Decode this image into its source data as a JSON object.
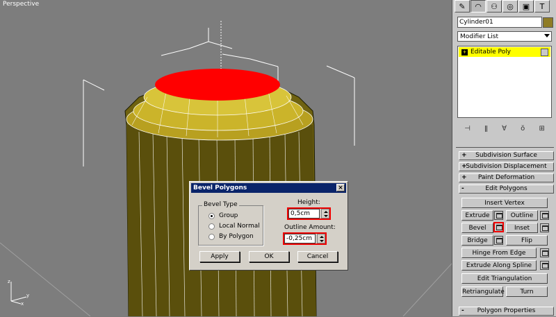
{
  "viewport": {
    "label": "Perspective",
    "colors": {
      "background": "#7d7d7d",
      "mesh": "#8c7a18",
      "selected_face": "#ff0000",
      "wire": "#ffffff"
    }
  },
  "command_panel": {
    "tabs": [
      "create-icon",
      "modify-icon",
      "hierarchy-icon",
      "motion-icon",
      "display-icon",
      "utilities-icon"
    ],
    "object_name": "Cylinder01",
    "object_color": "#8f7c25",
    "modifier_list": "Modifier List",
    "stack": {
      "item": "Editable Poly"
    }
  },
  "rollouts": {
    "subdivision_surface": {
      "sign": "+",
      "label": "Subdivision Surface"
    },
    "subdivision_displacement": {
      "sign": "+",
      "label": "Subdivision Displacement"
    },
    "paint_deformation": {
      "sign": "+",
      "label": "Paint Deformation"
    },
    "edit_polygons": {
      "sign": "-",
      "label": "Edit Polygons"
    },
    "polygon_properties": {
      "sign": "-",
      "label": "Polygon Properties"
    }
  },
  "edit_polygons": {
    "insert_vertex": "Insert Vertex",
    "extrude": "Extrude",
    "outline": "Outline",
    "bevel": "Bevel",
    "inset": "Inset",
    "bridge": "Bridge",
    "flip": "Flip",
    "hinge_from_edge": "Hinge From Edge",
    "extrude_along_spline": "Extrude Along Spline",
    "edit_triangulation": "Edit Triangulation",
    "retriangulate": "Retriangulate",
    "turn": "Turn"
  },
  "dialog": {
    "title": "Bevel Polygons",
    "close": "×",
    "bevel_type": {
      "label": "Bevel Type",
      "options": [
        "Group",
        "Local Normal",
        "By Polygon"
      ],
      "selected": "Group"
    },
    "height": {
      "label": "Height:",
      "value": "0,5cm"
    },
    "outline_amount": {
      "label": "Outline Amount:",
      "value": "-0,25cm"
    },
    "buttons": {
      "apply": "Apply",
      "ok": "OK",
      "cancel": "Cancel"
    }
  }
}
